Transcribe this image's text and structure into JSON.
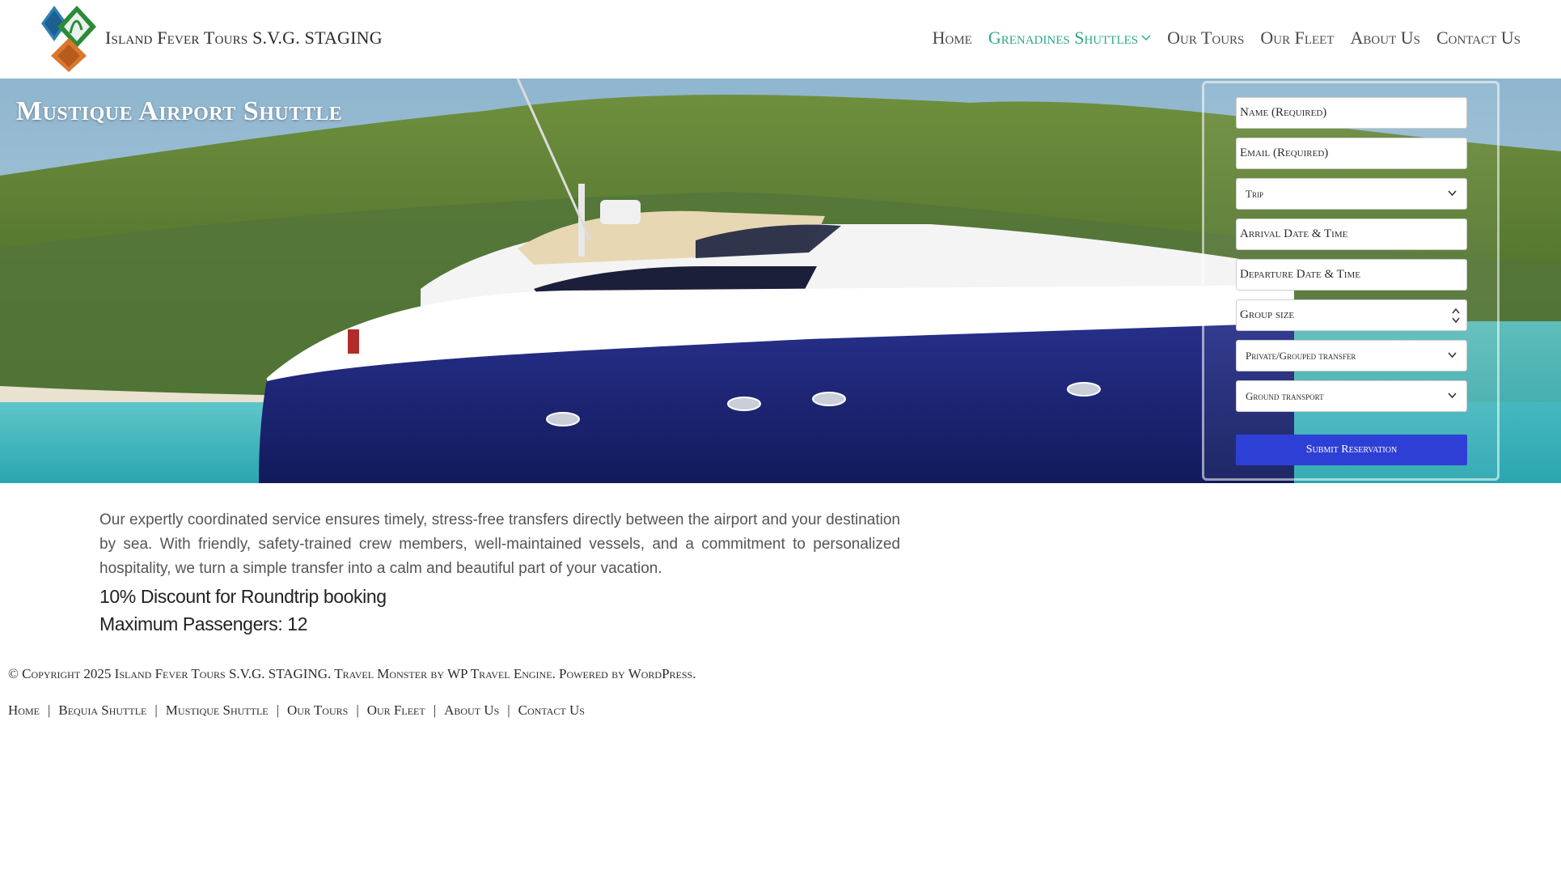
{
  "site": {
    "title": "Island Fever Tours S.V.G. STAGING"
  },
  "nav": {
    "items": [
      {
        "label": "Home"
      },
      {
        "label": "Grenadines Shuttles"
      },
      {
        "label": "Our Tours"
      },
      {
        "label": "Our Fleet"
      },
      {
        "label": "About Us"
      },
      {
        "label": "Contact Us"
      }
    ],
    "active_color": "#2aa88b"
  },
  "hero": {
    "title": "Mustique Airport Shuttle"
  },
  "form": {
    "name_placeholder": "Name (Required)",
    "email_placeholder": "Email (Required)",
    "trip_selected": "Trip",
    "arrival_placeholder": "Arrival Date & Time",
    "departure_placeholder": "Departure Date & Time",
    "group_size_placeholder": "Group size",
    "transfer_selected": "Private/Grouped transfer",
    "ground_selected": "Ground transport",
    "submit_label": "Submit Reservation",
    "submit_color": "#2e3fd6"
  },
  "content": {
    "description": "Our expertly coordinated service ensures timely, stress-free transfers directly between the airport and your destination by sea. With friendly, safety-trained crew members, well-maintained vessels, and a commitment to personalized hospitality, we turn a simple transfer into a calm and beautiful part of your vacation.",
    "discount": "10% Discount for Roundtrip booking",
    "max_passengers": "Maximum Passengers: 12"
  },
  "footer": {
    "copyright": "© Copyright 2025 Island Fever Tours S.V.G. STAGING. Travel Monster by WP Travel Engine. Powered by WordPress.",
    "links": [
      {
        "label": "Home"
      },
      {
        "label": "Bequia Shuttle"
      },
      {
        "label": "Mustique Shuttle"
      },
      {
        "label": "Our Tours"
      },
      {
        "label": "Our Fleet"
      },
      {
        "label": "About Us"
      },
      {
        "label": "Contact Us"
      }
    ]
  }
}
